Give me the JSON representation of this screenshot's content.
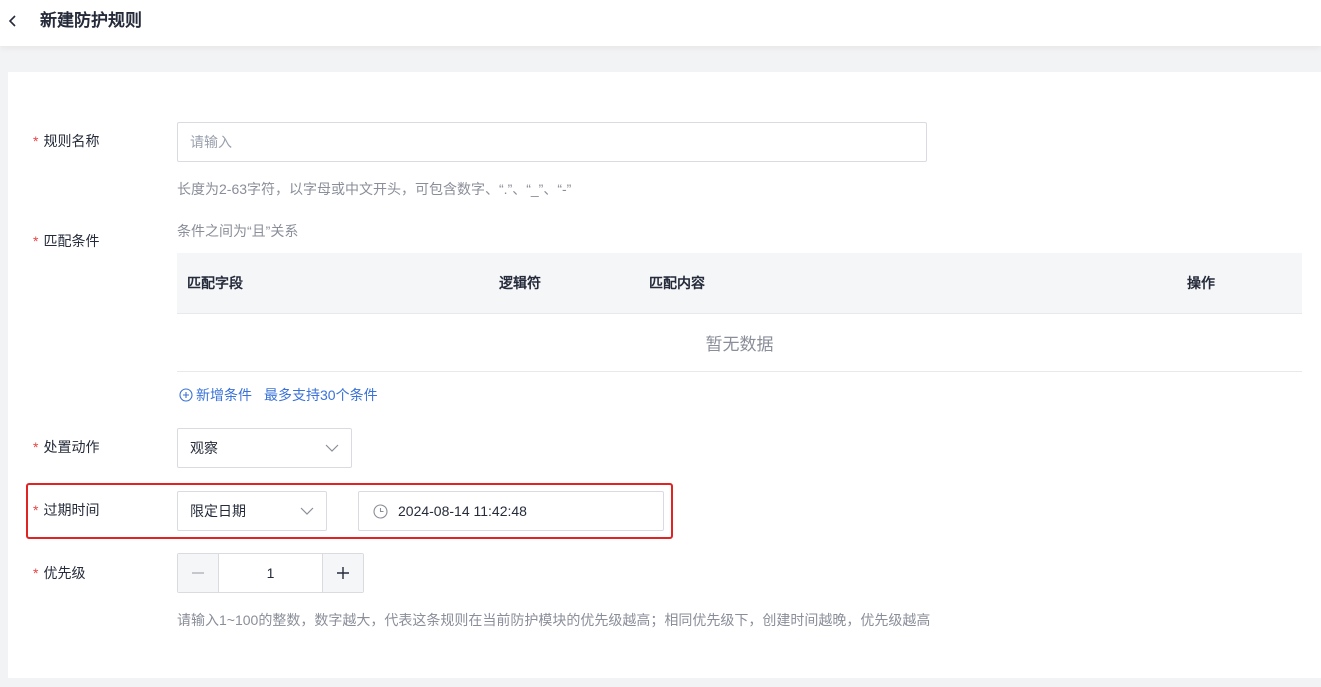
{
  "header": {
    "title": "新建防护规则"
  },
  "form": {
    "rule_name": {
      "label": "规则名称",
      "placeholder": "请输入",
      "help": "长度为2-63字符，以字母或中文开头，可包含数字、“.”、“_”、“-”"
    },
    "conditions": {
      "label": "匹配条件",
      "note": "条件之间为“且”关系",
      "columns": [
        "匹配字段",
        "逻辑符",
        "匹配内容",
        "操作"
      ],
      "empty_text": "暂无数据",
      "add_label": "新增条件",
      "limit_label": "最多支持30个条件"
    },
    "action": {
      "label": "处置动作",
      "value": "观察"
    },
    "expire": {
      "label": "过期时间",
      "mode": "限定日期",
      "datetime": "2024-08-14 11:42:48"
    },
    "priority": {
      "label": "优先级",
      "value": "1",
      "help": "请输入1~100的整数，数字越大，代表这条规则在当前防护模块的优先级越高；相同优先级下，创建时间越晚，优先级越高"
    },
    "required_mark": "*"
  },
  "colors": {
    "required": "#e54545",
    "link": "#3a72d8",
    "highlight": "#e02323"
  },
  "icons": {
    "back": "chevron-left-icon",
    "add": "plus-circle-icon",
    "dropdown": "chevron-down-icon",
    "clock": "clock-icon",
    "minus": "minus-icon",
    "plus": "plus-icon"
  }
}
